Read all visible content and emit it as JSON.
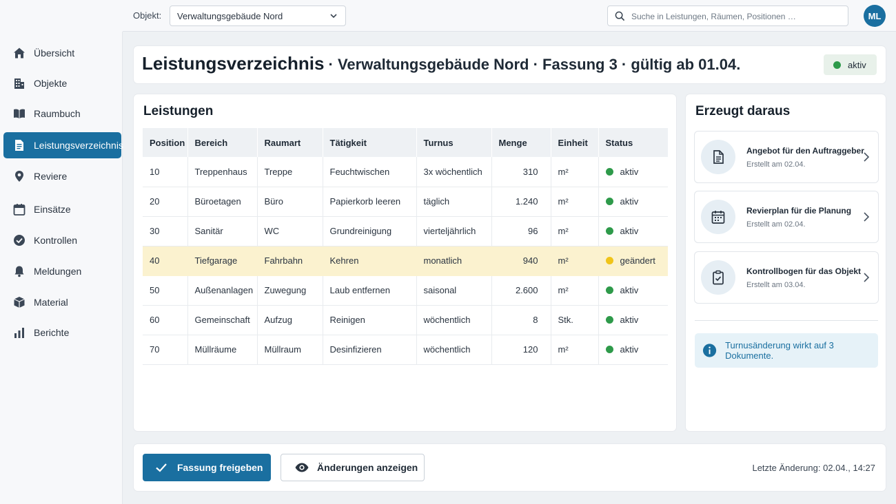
{
  "header": {
    "object_label": "Objekt:",
    "object_value": "Verwaltungsgebäude Nord",
    "search_placeholder": "Suche in Leistungen, Räumen, Positionen …",
    "user_initials": "ML"
  },
  "sidebar": {
    "items": [
      {
        "label": "Übersicht",
        "icon": "home-icon"
      },
      {
        "label": "Objekte",
        "icon": "building-icon"
      },
      {
        "label": "Raumbuch",
        "icon": "book-icon"
      },
      {
        "label": "Leistungsverzeichnis",
        "icon": "document-icon",
        "active": true
      },
      {
        "label": "Reviere",
        "icon": "location-pin-icon"
      },
      {
        "label": "Einsätze",
        "icon": "calendar-icon"
      },
      {
        "label": "Kontrollen",
        "icon": "check-circle-icon"
      },
      {
        "label": "Meldungen",
        "icon": "bell-icon"
      },
      {
        "label": "Material",
        "icon": "box-icon"
      },
      {
        "label": "Berichte",
        "icon": "bar-chart-icon"
      }
    ]
  },
  "title": {
    "main": "Leistungsverzeichnis",
    "sub": " · Verwaltungsgebäude Nord · Fassung 3 · gültig ab 01.04.",
    "status": "aktiv"
  },
  "services": {
    "title": "Leistungen",
    "columns": [
      "Position",
      "Bereich",
      "Raumart",
      "Tätigkeit",
      "Turnus",
      "Menge",
      "Einheit",
      "Status"
    ],
    "rows": [
      {
        "position": "10",
        "bereich": "Treppenhaus",
        "raumart": "Treppe",
        "taetigkeit": "Feuchtwischen",
        "turnus": "3x wöchentlich",
        "menge": "310",
        "einheit": "m²",
        "status": "aktiv",
        "status_color": "#2e9a4a"
      },
      {
        "position": "20",
        "bereich": "Büroetagen",
        "raumart": "Büro",
        "taetigkeit": "Papierkorb leeren",
        "turnus": "täglich",
        "menge": "1.240",
        "einheit": "m²",
        "status": "aktiv",
        "status_color": "#2e9a4a"
      },
      {
        "position": "30",
        "bereich": "Sanitär",
        "raumart": "WC",
        "taetigkeit": "Grundreinigung",
        "turnus": "vierteljährlich",
        "menge": "96",
        "einheit": "m²",
        "status": "aktiv",
        "status_color": "#2e9a4a"
      },
      {
        "position": "40",
        "bereich": "Tiefgarage",
        "raumart": "Fahrbahn",
        "taetigkeit": "Kehren",
        "turnus": "monatlich",
        "menge": "940",
        "einheit": "m²",
        "status": "geändert",
        "status_color": "#f0c419",
        "highlighted": true
      },
      {
        "position": "50",
        "bereich": "Außenanlagen",
        "raumart": "Zuwegung",
        "taetigkeit": "Laub entfernen",
        "turnus": "saisonal",
        "menge": "2.600",
        "einheit": "m²",
        "status": "aktiv",
        "status_color": "#2e9a4a"
      },
      {
        "position": "60",
        "bereich": "Gemeinschaft",
        "raumart": "Aufzug",
        "taetigkeit": "Reinigen",
        "turnus": "wöchentlich",
        "menge": "8",
        "einheit": "Stk.",
        "status": "aktiv",
        "status_color": "#2e9a4a"
      },
      {
        "position": "70",
        "bereich": "Müllräume",
        "raumart": "Müllraum",
        "taetigkeit": "Desinfizieren",
        "turnus": "wöchentlich",
        "menge": "120",
        "einheit": "m²",
        "status": "aktiv",
        "status_color": "#2e9a4a"
      }
    ]
  },
  "generated": {
    "title": "Erzeugt daraus",
    "documents": [
      {
        "title": "Angebot für den Auftraggeber",
        "sub": "Erstellt am 02.04.",
        "icon": "document-icon"
      },
      {
        "title": "Revierplan für die Planung",
        "sub": "Erstellt am 02.04.",
        "icon": "calendar-icon"
      },
      {
        "title": "Kontrollbogen für das Objekt",
        "sub": "Erstellt am 03.04.",
        "icon": "clipboard-check-icon"
      }
    ],
    "info": "Turnusänderung wirkt auf 3 Dokumente."
  },
  "actions": {
    "release": "Fassung freigeben",
    "show_changes": "Änderungen anzeigen",
    "last_change": "Letzte Änderung: 02.04., 14:27"
  },
  "colors": {
    "primary": "#1a6fa0",
    "active_green": "#2e9a4a",
    "changed_yellow": "#f0c419",
    "highlight_row": "#fbf2cf"
  }
}
